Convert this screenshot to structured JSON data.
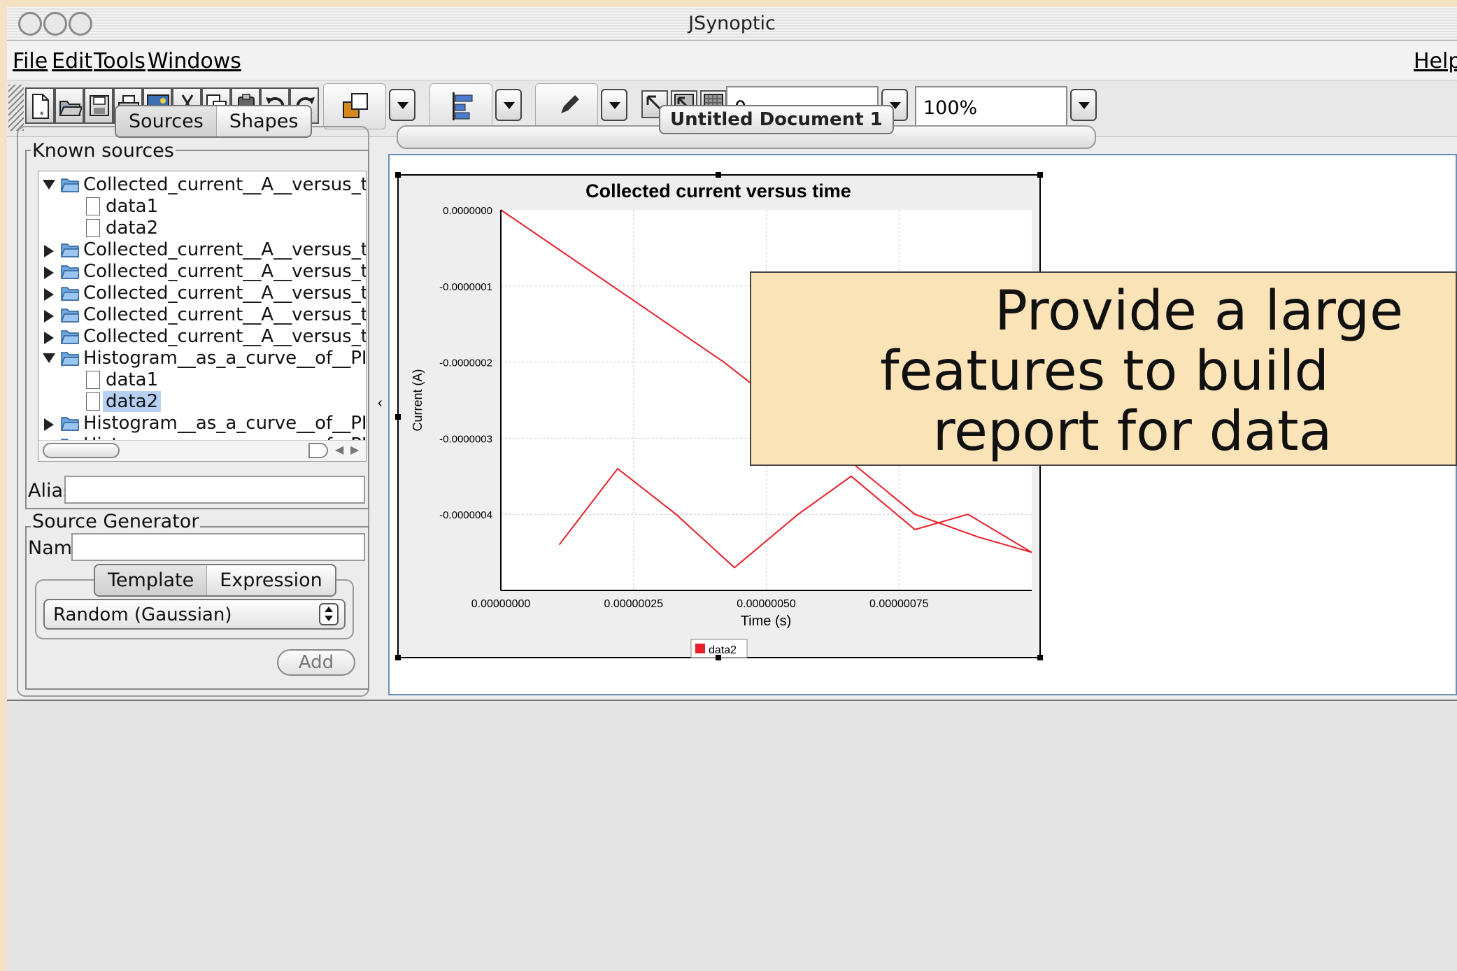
{
  "window": {
    "title": "JSynoptic"
  },
  "menubar": {
    "items": [
      "File",
      "Edit",
      "Tools",
      "Windows"
    ],
    "help": "Help"
  },
  "toolbar": {
    "icons": [
      "new-document-icon",
      "open-folder-icon",
      "save-icon",
      "print-icon",
      "image-icon",
      "cut-icon",
      "copy-icon",
      "paste-icon",
      "undo-icon",
      "redo-icon"
    ],
    "line_width_value": "0",
    "zoom_value": "100%"
  },
  "left_panel": {
    "tabs": [
      "Sources",
      "Shapes"
    ],
    "known_sources": {
      "title": "Known sources",
      "rows": [
        {
          "level": 0,
          "expanded": true,
          "label": "Collected_current__A__versus_time__s_"
        },
        {
          "level": 1,
          "label": "data1"
        },
        {
          "level": 1,
          "label": "data2"
        },
        {
          "level": 0,
          "expanded": false,
          "label": "Collected_current__A__versus_time__s_"
        },
        {
          "level": 0,
          "expanded": false,
          "label": "Collected_current__A__versus_time__s_"
        },
        {
          "level": 0,
          "expanded": false,
          "label": "Collected_current__A__versus_time__s_"
        },
        {
          "level": 0,
          "expanded": false,
          "label": "Collected_current__A__versus_time__s_"
        },
        {
          "level": 0,
          "expanded": false,
          "label": "Collected_current__A__versus_time__s_"
        },
        {
          "level": 0,
          "expanded": true,
          "label": "Histogram__as_a_curve__of__PICVolDist"
        },
        {
          "level": 1,
          "label": "data1"
        },
        {
          "level": 1,
          "label": "data2",
          "selected": true
        },
        {
          "level": 0,
          "expanded": false,
          "label": "Histogram__as_a_curve__of__PICVolDist"
        },
        {
          "level": 0,
          "expanded": false,
          "label": "Histogram__as_a_curve__of__PICVolDist"
        }
      ]
    },
    "alias_label": "Alias",
    "source_generator": {
      "title": "Source Generator",
      "name_label": "Name",
      "tabs": [
        "Template",
        "Expression"
      ],
      "selected_template": "Random (Gaussian)",
      "add_label": "Add"
    }
  },
  "document": {
    "tab_label": "Untitled Document 1"
  },
  "callout": {
    "text_lines": [
      "Provide a large",
      "features to build",
      "report for data"
    ]
  },
  "chart_data": {
    "type": "line",
    "title": "Collected current versus time",
    "xlabel": "Time (s)",
    "ylabel": "Current (A)",
    "xlim": [
      0,
      1e-06
    ],
    "ylim": [
      -5e-07,
      0.0
    ],
    "x_ticks": [
      "0.00000000",
      "0.00000025",
      "0.00000050",
      "0.00000075"
    ],
    "y_ticks": [
      "0.0000000",
      "-0.0000001",
      "-0.0000002",
      "-0.0000003",
      "-0.0000004"
    ],
    "grid": true,
    "legend": "bottom-center",
    "series": [
      {
        "name": "data2",
        "color": "#e8202a",
        "x": [
          0,
          4.2e-07,
          6.4e-07,
          7.8e-07,
          9e-07,
          1e-06,
          8.8e-07,
          7.8e-07,
          6.6e-07,
          5.6e-07,
          4.4e-07,
          3.3e-07,
          2.2e-07,
          1.1e-07
        ],
        "y": [
          0,
          -2e-07,
          -3.2e-07,
          -4e-07,
          -4.3e-07,
          -4.5e-07,
          -4e-07,
          -4.2e-07,
          -3.5e-07,
          -4e-07,
          -4.7e-07,
          -4e-07,
          -3.4e-07,
          -4.4e-07
        ]
      }
    ]
  }
}
